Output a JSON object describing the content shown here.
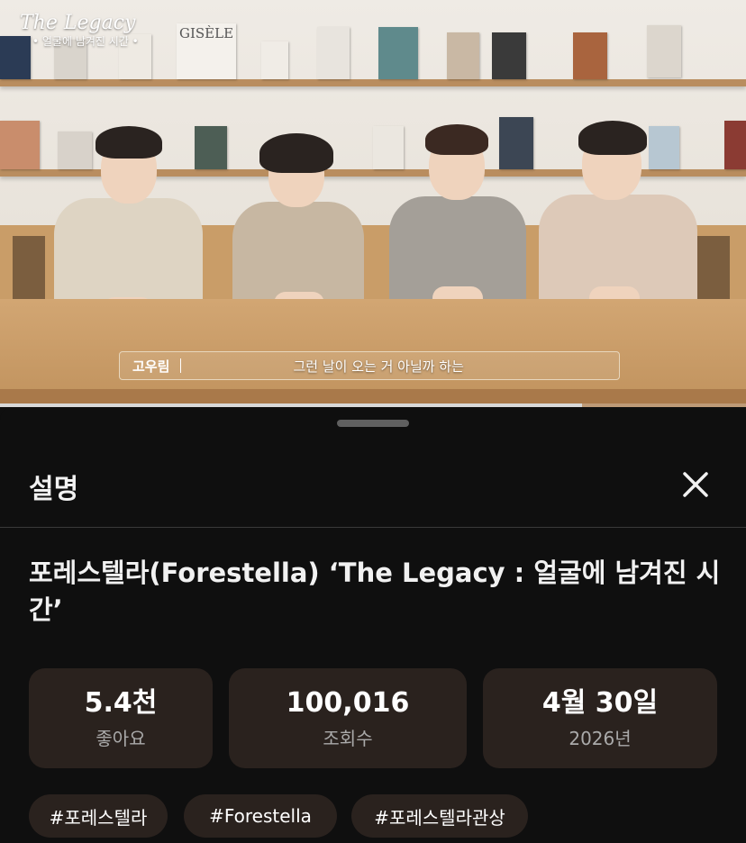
{
  "video": {
    "logo_title": "The Legacy",
    "logo_subtitle": "• 얼굴에 남겨진 시간 •",
    "caption_speaker": "고우림",
    "caption_text": "그런 날이 오는 거 아닐까 하는",
    "book_labels": [
      "GISÈLE"
    ],
    "progress_fraction": 0.78
  },
  "sheet": {
    "title": "설명",
    "video_title": "포레스텔라(Forestella) ‘The Legacy : 얼굴에 남겨진 시간’",
    "stats": [
      {
        "value": "5.4천",
        "label": "좋아요"
      },
      {
        "value": "100,016",
        "label": "조회수"
      },
      {
        "value": "4월 30일",
        "label": "2026년"
      }
    ],
    "hashtags": [
      "#포레스텔라",
      "#Forestella",
      "#포레스텔라관상"
    ]
  },
  "icons": {
    "close": "close-icon"
  },
  "colors": {
    "background": "#0f0f0f",
    "card": "#2a221e",
    "divider": "#3a3a3a"
  }
}
